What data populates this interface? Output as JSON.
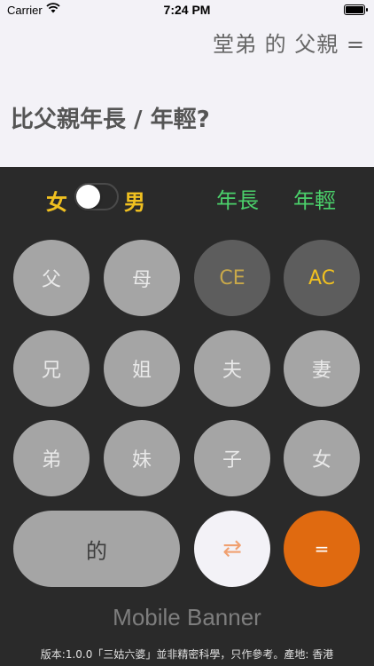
{
  "status_bar": {
    "carrier": "Carrier",
    "time": "7:24 PM",
    "wifi_icon": "wifi-icon",
    "battery_icon": "battery-icon"
  },
  "display": {
    "expression": "堂弟 的 父親 =",
    "question": "比父親年長 / 年輕?"
  },
  "gender": {
    "female": "女",
    "male": "男",
    "toggle_on": false
  },
  "age_options": {
    "older": "年長",
    "younger": "年輕"
  },
  "keys": {
    "father": "父",
    "mother": "母",
    "clear_entry": "CE",
    "all_clear": "AC",
    "elder_brother": "兄",
    "elder_sister": "姐",
    "husband": "夫",
    "wife": "妻",
    "younger_brother": "弟",
    "younger_sister": "妹",
    "son": "子",
    "daughter": "女",
    "of": "的",
    "swap": "⇄",
    "equals": "="
  },
  "banner": "Mobile Banner",
  "footer": "版本:1.0.0「三姑六婆」並非精密科學，只作參考。產地: 香港",
  "colors": {
    "accent_yellow": "#f0c020",
    "accent_green": "#4bd16b",
    "equals_orange": "#e06a10",
    "key_gray": "#a5a5a5",
    "key_dark": "#5d5d5d",
    "background": "#2a2a2a"
  }
}
